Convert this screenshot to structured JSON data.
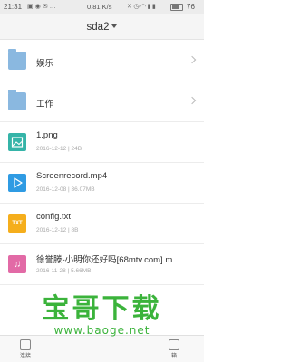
{
  "status_bar": {
    "time": "21:31",
    "speed": "0.81 K/s",
    "battery": "76",
    "left_icons": [
      "image-icon",
      "chat-icon",
      "message-icon",
      "more-icon"
    ],
    "right_icons": [
      "mute-icon",
      "alarm-icon",
      "wifi-icon",
      "signal-icon"
    ]
  },
  "header": {
    "title": "sda2"
  },
  "files": [
    {
      "kind": "folder",
      "icon": "folder-icon",
      "name": "娱乐",
      "meta": ""
    },
    {
      "kind": "folder",
      "icon": "folder-icon",
      "name": "工作",
      "meta": ""
    },
    {
      "kind": "image",
      "icon": "image-file-icon",
      "name": "1.png",
      "meta": "2016-12-12 | 24B"
    },
    {
      "kind": "video",
      "icon": "video-file-icon",
      "name": "Screenrecord.mp4",
      "meta": "2016-12-08 | 36.07MB"
    },
    {
      "kind": "text",
      "icon": "text-file-icon",
      "icon_label": "TXT",
      "name": "config.txt",
      "meta": "2016-12-12 | 8B"
    },
    {
      "kind": "audio",
      "icon": "music-file-icon",
      "name": "徐誉滕-小明你还好吗[68mtv.com].m..",
      "meta": "2016-11-28 | 5.66MB"
    }
  ],
  "bottom_bar": {
    "tabs": [
      {
        "label": "连接"
      },
      {
        "label": "箱"
      }
    ]
  },
  "watermark": {
    "title": "宝哥下载",
    "url": "www.baoge.net"
  },
  "colors": {
    "folder": "#8ab8e0",
    "image": "#35b4a8",
    "video": "#2f9be3",
    "text": "#f5ae1c",
    "audio": "#e26aa6",
    "watermark": "#3bb33b"
  }
}
